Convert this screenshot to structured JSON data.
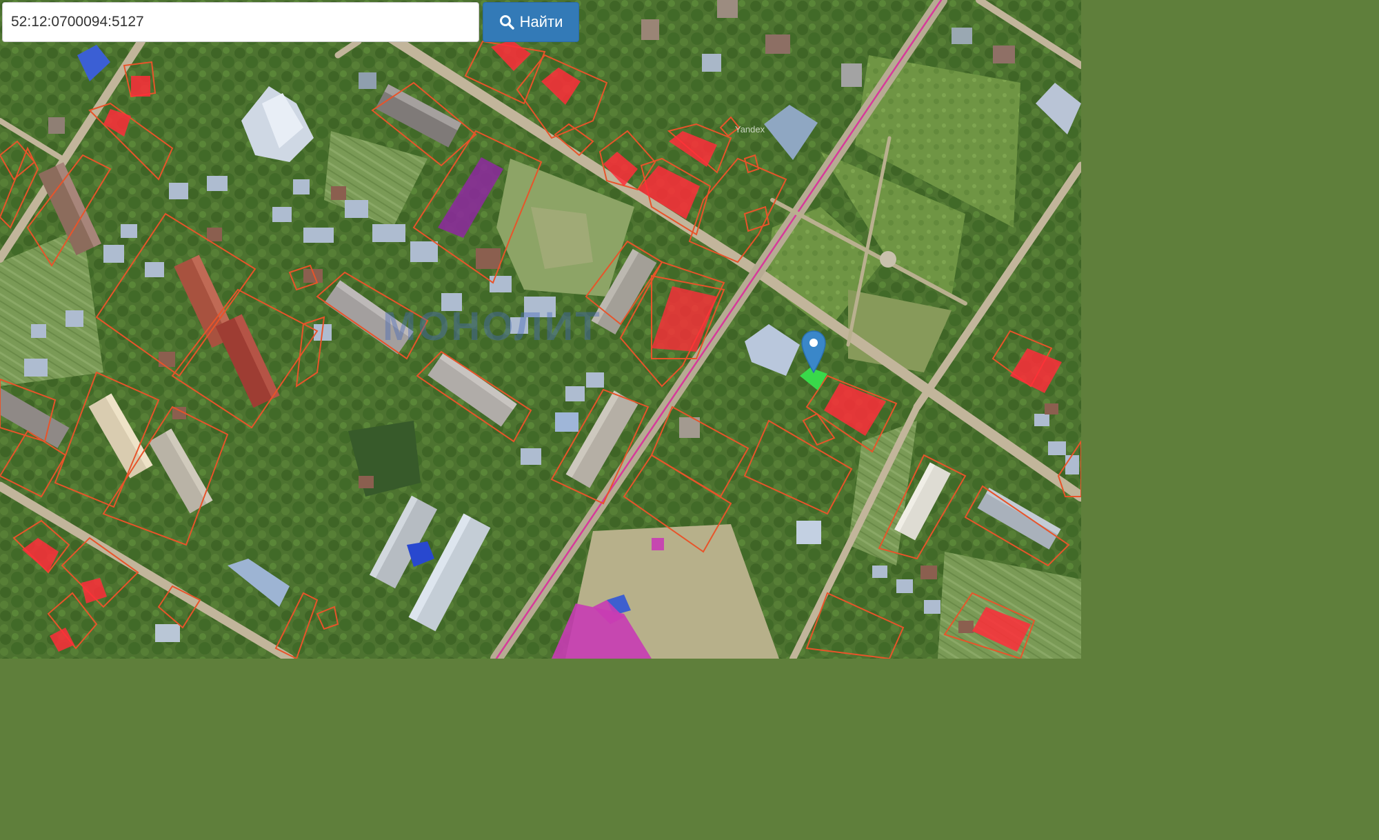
{
  "search": {
    "value": "52:12:0700094:5127",
    "button_label": "Найти",
    "button_icon": "search-icon"
  },
  "map": {
    "watermark": "МОНОЛИТ",
    "provider_label": "Yandex",
    "marker_icon": "map-pin-icon",
    "colors": {
      "parcel_outline": "#e8542a",
      "registered_building": "#ff2d3a",
      "highlighted_parcel": "#39d94a",
      "magenta_object": "#c83cb4",
      "purple_object": "#8c2a9c",
      "marker": "#3a87c9",
      "boundary_line": "#d63a9a"
    }
  }
}
